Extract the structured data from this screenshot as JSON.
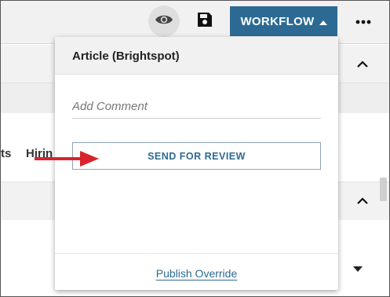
{
  "toolbar": {
    "workflow_label": "WORKFLOW",
    "icons": [
      "eye-icon",
      "save-icon",
      "caret-up-icon",
      "more-icon"
    ]
  },
  "background": {
    "tab_left_partial": "ts",
    "tab_right_partial": "Hirin"
  },
  "workflow_panel": {
    "title": "Article (Brightspot)",
    "comment_placeholder": "Add Comment",
    "send_for_review_label": "SEND FOR REVIEW",
    "publish_override_label": "Publish Override"
  },
  "colors": {
    "accent": "#2c6a93",
    "annotation_arrow": "#d9232e"
  }
}
